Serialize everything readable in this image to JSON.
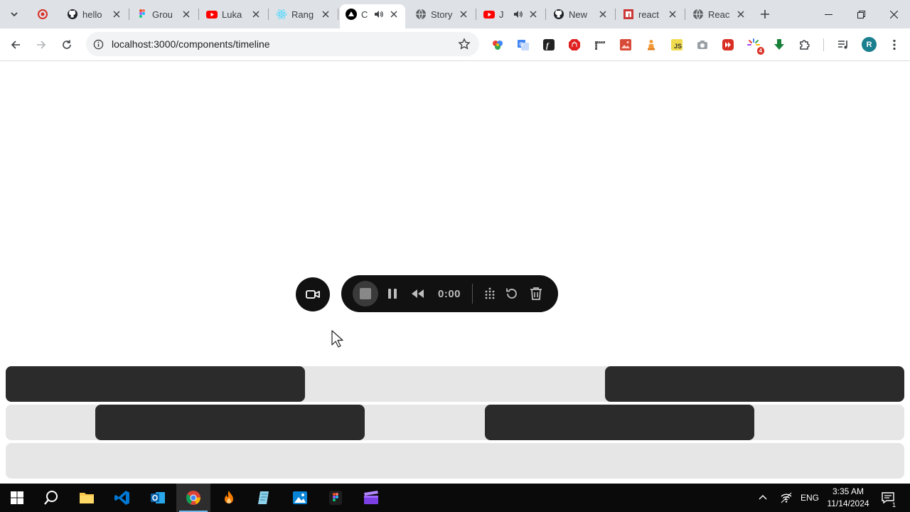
{
  "browser": {
    "tabs": [
      {
        "title": "",
        "icon": "record-icon",
        "color": "#d93025"
      },
      {
        "title": "hello",
        "icon": "github-icon"
      },
      {
        "title": "Grou",
        "icon": "figma-icon"
      },
      {
        "title": "Luka",
        "icon": "youtube-icon"
      },
      {
        "title": "Rang",
        "icon": "react-icon"
      },
      {
        "title": "C",
        "icon": "triangle-icon",
        "active": true,
        "audio": true
      },
      {
        "title": "Story",
        "icon": "globe-icon"
      },
      {
        "title": "J",
        "icon": "youtube-icon",
        "audio": true
      },
      {
        "title": "New",
        "icon": "github-icon"
      },
      {
        "title": "react",
        "icon": "npm-icon"
      },
      {
        "title": "Reac",
        "icon": "globe-icon"
      }
    ],
    "url": "localhost:3000/components/timeline",
    "profile_initial": "R",
    "extension_badge": "4"
  },
  "recorder": {
    "time": "0:00",
    "buttons": [
      "camera-icon",
      "stop-icon",
      "pause-icon",
      "rewind-icon",
      "grid-icon",
      "reset-icon",
      "trash-icon"
    ]
  },
  "timeline": {
    "tracks": [
      {
        "segments": [
          [
            0,
            0.333
          ],
          [
            0.667,
            1.0
          ]
        ]
      },
      {
        "segments": [
          [
            0.1,
            0.4
          ],
          [
            0.533,
            0.833
          ]
        ]
      },
      {
        "segments": []
      }
    ]
  },
  "taskbar": {
    "language": "ENG",
    "time": "3:35 AM",
    "date": "11/14/2024",
    "notification_count": "1"
  },
  "colors": {
    "accent": "#111111",
    "track": "#e6e6e6",
    "segment": "#2b2b2b"
  }
}
